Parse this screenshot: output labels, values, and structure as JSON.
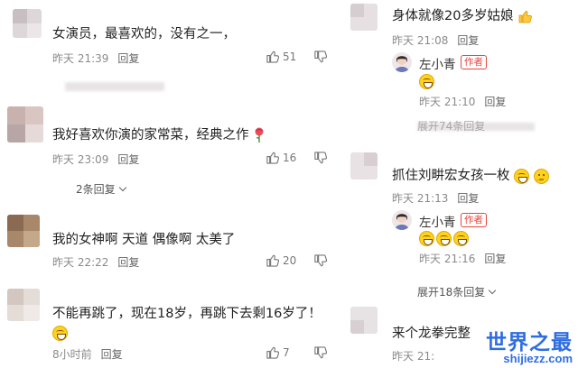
{
  "comments_left": [
    {
      "text": "女演员，最喜欢的，没有之一，",
      "time": "昨天 21:39",
      "reply": "回复",
      "likes": "51"
    },
    {
      "text": "我好喜欢你演的家常菜，经典之作",
      "time": "昨天 23:09",
      "reply": "回复",
      "likes": "16",
      "expand": "2条回复"
    },
    {
      "text": "我的女神啊 天道 偶像啊 太美了",
      "time": "昨天 22:22",
      "reply": "回复",
      "likes": "20"
    },
    {
      "text": "不能再跳了，现在18岁，再跳下去剩16岁了！",
      "time": "8小时前",
      "reply": "回复",
      "likes": "7"
    }
  ],
  "comments_right": [
    {
      "text": "身体就像20多岁姑娘",
      "time": "昨天 21:08",
      "reply": "回复",
      "author_reply": {
        "name": "左小青",
        "badge": "作者",
        "time": "昨天 21:10",
        "reply": "回复"
      },
      "expand": "展开74条回复"
    },
    {
      "text": "抓住刘畊宏女孩一枚",
      "time": "昨天 21:13",
      "reply": "回复",
      "author_reply": {
        "name": "左小青",
        "badge": "作者",
        "time": "昨天 21:16",
        "reply": "回复"
      },
      "expand": "展开18条回复"
    },
    {
      "text": "来个龙拳完整",
      "time": "昨天 21:"
    }
  ],
  "watermark": {
    "title": "世界之最",
    "url": "shijiezz.com"
  }
}
